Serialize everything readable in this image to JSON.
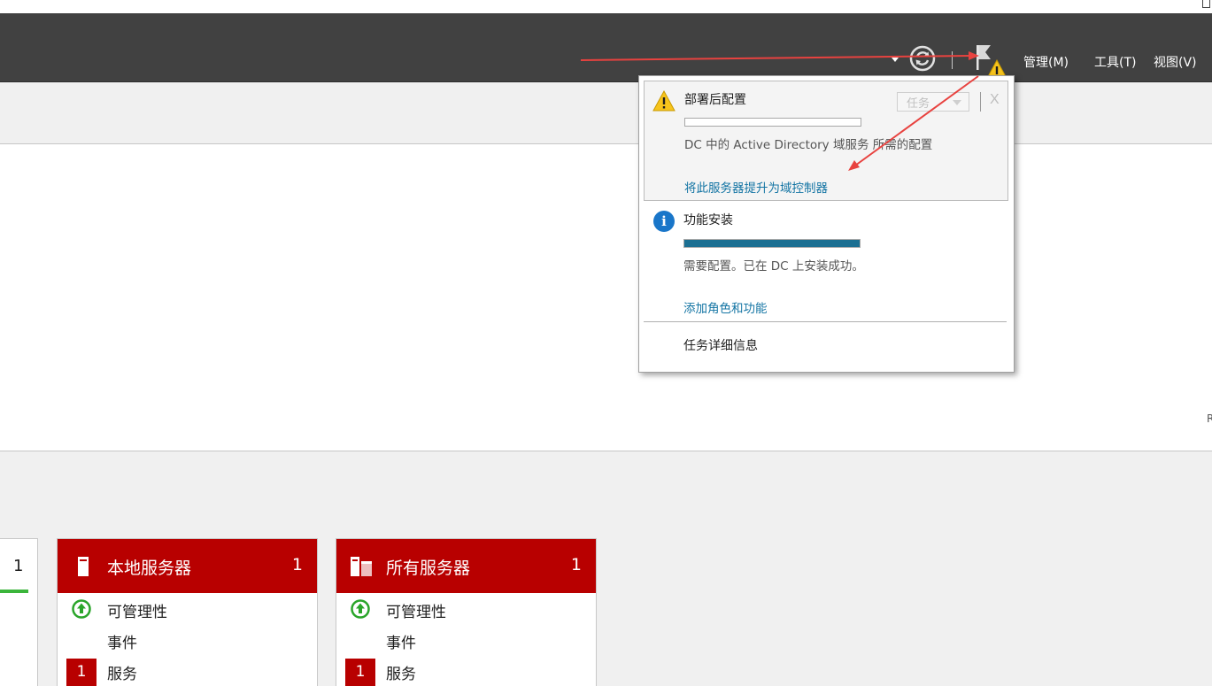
{
  "topbar": {
    "refresh_icon": "refresh-icon",
    "flag_icon": "notification-flag-warning-icon",
    "menu": [
      {
        "label": "管理(M)"
      },
      {
        "label": "工具(T)"
      },
      {
        "label": "视图(V)"
      }
    ]
  },
  "notifications": {
    "post_deploy": {
      "title": "部署后配置",
      "icon": "warning-icon",
      "progress": 0,
      "task_button": "任务",
      "close": "X",
      "description": "DC 中的 Active Directory 域服务 所需的配置",
      "link": "将此服务器提升为域控制器"
    },
    "feature_install": {
      "title": "功能安装",
      "icon": "info-icon",
      "info_glyph": "i",
      "progress": 1.0,
      "description": "需要配置。已在 DC 上安装成功。",
      "link": "添加角色和功能"
    },
    "task_details": "任务详细信息"
  },
  "tiles": {
    "partial": {
      "count": "1"
    },
    "local_server": {
      "title": "本地服务器",
      "count": "1",
      "rows": [
        "可管理性",
        "事件",
        "服务"
      ],
      "services_badge": "1"
    },
    "all_servers": {
      "title": "所有服务器",
      "count": "1",
      "rows": [
        "可管理性",
        "事件",
        "服务"
      ],
      "services_badge": "1"
    }
  },
  "colors": {
    "topbar": "#414141",
    "tile_header": "#b80000",
    "link": "#1475a4",
    "progress_fill": "#1b6f92",
    "warning": "#f7c41c",
    "annotation_arrow": "#e8423f"
  }
}
